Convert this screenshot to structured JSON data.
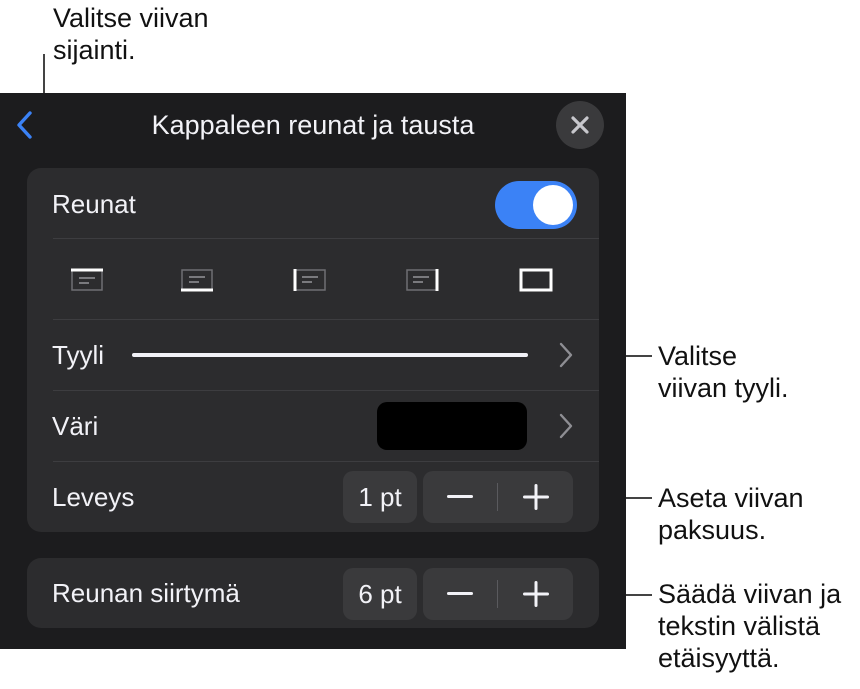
{
  "callouts": {
    "position": [
      "Valitse viivan",
      "sijainti."
    ],
    "style": [
      "Valitse",
      "viivan tyyli."
    ],
    "thickness": [
      "Aseta viivan",
      "paksuus."
    ],
    "offset": [
      "Säädä viivan ja",
      "tekstin välistä",
      "etäisyyttä."
    ]
  },
  "header": {
    "title": "Kappaleen reunat ja tausta",
    "back_icon": "chevron-left-icon",
    "close_icon": "close-icon"
  },
  "borders": {
    "label": "Reunat",
    "enabled": true,
    "positions": [
      "top",
      "bottom",
      "left",
      "right",
      "all"
    ]
  },
  "style_row": {
    "label": "Tyyli"
  },
  "color_row": {
    "label": "Väri",
    "value": "#000000"
  },
  "width_row": {
    "label": "Leveys",
    "value": "1 pt"
  },
  "offset_row": {
    "label": "Reunan siirtymä",
    "value": "6 pt"
  },
  "colors": {
    "accent": "#3b82f6",
    "panel": "#1c1c1e",
    "group": "#2c2c2e",
    "control": "#3a3a3c"
  }
}
